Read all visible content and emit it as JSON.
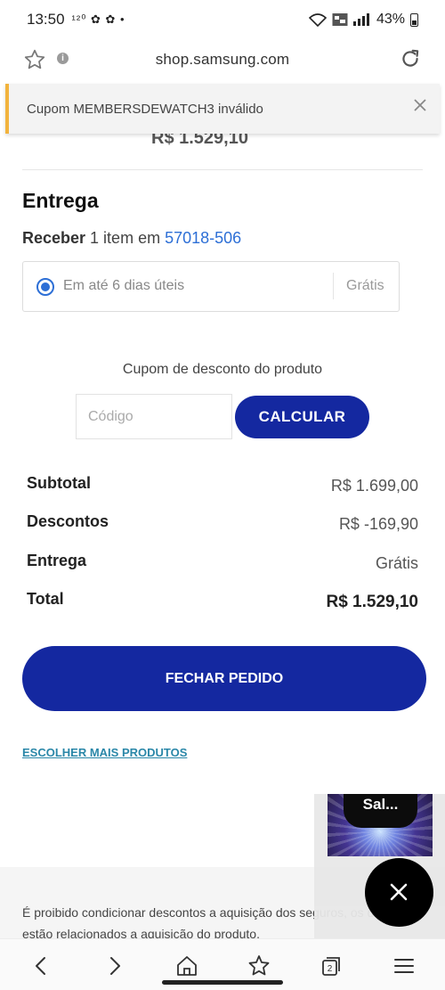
{
  "status_bar": {
    "time": "13:50",
    "left_icons_text": "¹²⁰ ✿ ✿ •",
    "battery": "43%"
  },
  "browser": {
    "url": "shop.samsung.com"
  },
  "toast": {
    "message": "Cupom MEMBERSDEWATCH3 inválido"
  },
  "cart": {
    "previous_price": "R$ 1.529,10"
  },
  "delivery": {
    "heading": "Entrega",
    "receive_label": "Receber",
    "receive_text": " 1 item em ",
    "zip": "57018-506",
    "option_label": "Em até 6 dias úteis",
    "option_price": "Grátis"
  },
  "coupon": {
    "title": "Cupom de desconto do produto",
    "placeholder": "Código",
    "button": "CALCULAR"
  },
  "summary": {
    "rows": [
      {
        "label": "Subtotal",
        "value": "R$ 1.699,00"
      },
      {
        "label": "Descontos",
        "value": "R$ -169,90"
      },
      {
        "label": "Entrega",
        "value": "Grátis"
      },
      {
        "label": "Total",
        "value": "R$ 1.529,10"
      }
    ]
  },
  "actions": {
    "checkout": "FECHAR PEDIDO",
    "more_products": "ESCOLHER MAIS PRODUTOS"
  },
  "footer": {
    "text": "É proibido condicionar descontos a aquisição dos seguros, os descontos estão relacionados a aquisição do produto."
  },
  "floating_video": {
    "pill_text": "Sal..."
  },
  "colors": {
    "brand_blue": "#1428a0",
    "link_blue": "#2d6fd6",
    "warning_accent": "#f2b33d"
  }
}
